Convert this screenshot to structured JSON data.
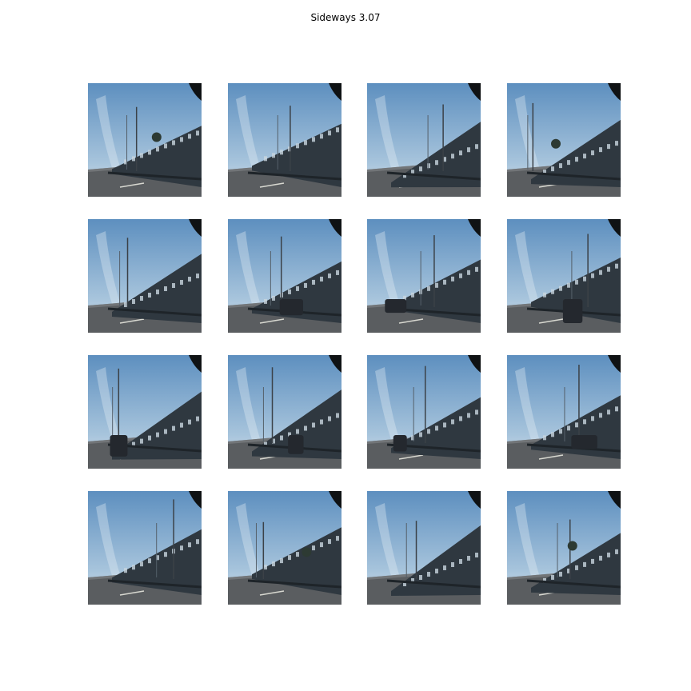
{
  "figure": {
    "title": "Sideways 3.07"
  },
  "frames": [
    {
      "variant": 0
    },
    {
      "variant": 1
    },
    {
      "variant": 2
    },
    {
      "variant": 3
    },
    {
      "variant": 4
    },
    {
      "variant": 5
    },
    {
      "variant": 6
    },
    {
      "variant": 7
    },
    {
      "variant": 8
    },
    {
      "variant": 9
    },
    {
      "variant": 10
    },
    {
      "variant": 11
    },
    {
      "variant": 12
    },
    {
      "variant": 13
    },
    {
      "variant": 14
    },
    {
      "variant": 15
    }
  ]
}
